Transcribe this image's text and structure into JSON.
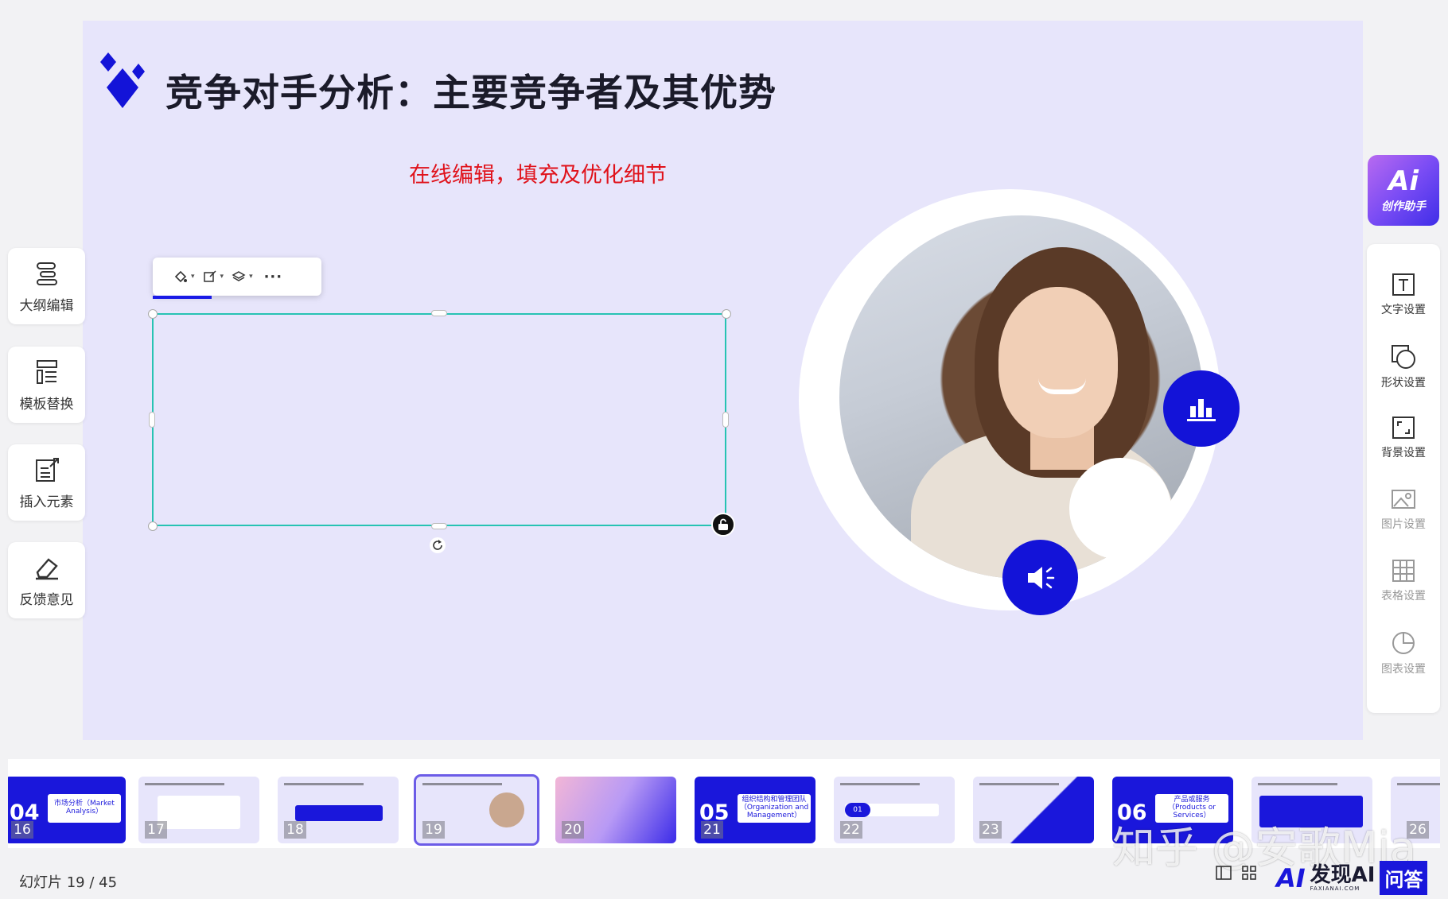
{
  "slide": {
    "title": "竞争对手分析：主要竞争者及其优势",
    "subtitle": "在线编辑，填充及优化细节",
    "accent_color": "#1313d8",
    "subtitle_color": "#e0121b",
    "selection_color": "#27c3b3"
  },
  "left_sidebar": {
    "items": [
      {
        "label": "大纲编辑",
        "icon": "outline-icon"
      },
      {
        "label": "模板替换",
        "icon": "template-icon"
      },
      {
        "label": "插入元素",
        "icon": "insert-element-icon"
      },
      {
        "label": "反馈意见",
        "icon": "feedback-icon"
      }
    ]
  },
  "ai_assistant": {
    "logo_text": "Ai",
    "label": "创作助手"
  },
  "right_sidebar": {
    "items": [
      {
        "label": "文字设置",
        "icon": "text-settings-icon",
        "enabled": true
      },
      {
        "label": "形状设置",
        "icon": "shape-settings-icon",
        "enabled": true
      },
      {
        "label": "背景设置",
        "icon": "background-settings-icon",
        "enabled": true
      },
      {
        "label": "图片设置",
        "icon": "image-settings-icon",
        "enabled": false
      },
      {
        "label": "表格设置",
        "icon": "table-settings-icon",
        "enabled": false
      },
      {
        "label": "图表设置",
        "icon": "chart-settings-icon",
        "enabled": false
      }
    ]
  },
  "thumbnails": [
    {
      "num": "16",
      "big": "04",
      "card": "市场分析（Market Analysis）"
    },
    {
      "num": "17"
    },
    {
      "num": "18"
    },
    {
      "num": "19",
      "active": true
    },
    {
      "num": "20"
    },
    {
      "num": "21",
      "big": "05",
      "card": "组织结构和管理团队（Organization and Management）"
    },
    {
      "num": "22",
      "badge": "01"
    },
    {
      "num": "23"
    },
    {
      "num": "",
      "big": "06",
      "card": "产品或服务（Products or Services）"
    },
    {
      "num": ""
    },
    {
      "num": "26"
    }
  ],
  "footer": {
    "slide_label": "幻灯片",
    "slide_counter": "19 / 45",
    "watermark": "知乎 @安歌Mia",
    "brand_ai": "AI",
    "brand_name": "发现AI",
    "brand_domain": "FAXIANAI.COM",
    "brand_qa": "问答"
  }
}
